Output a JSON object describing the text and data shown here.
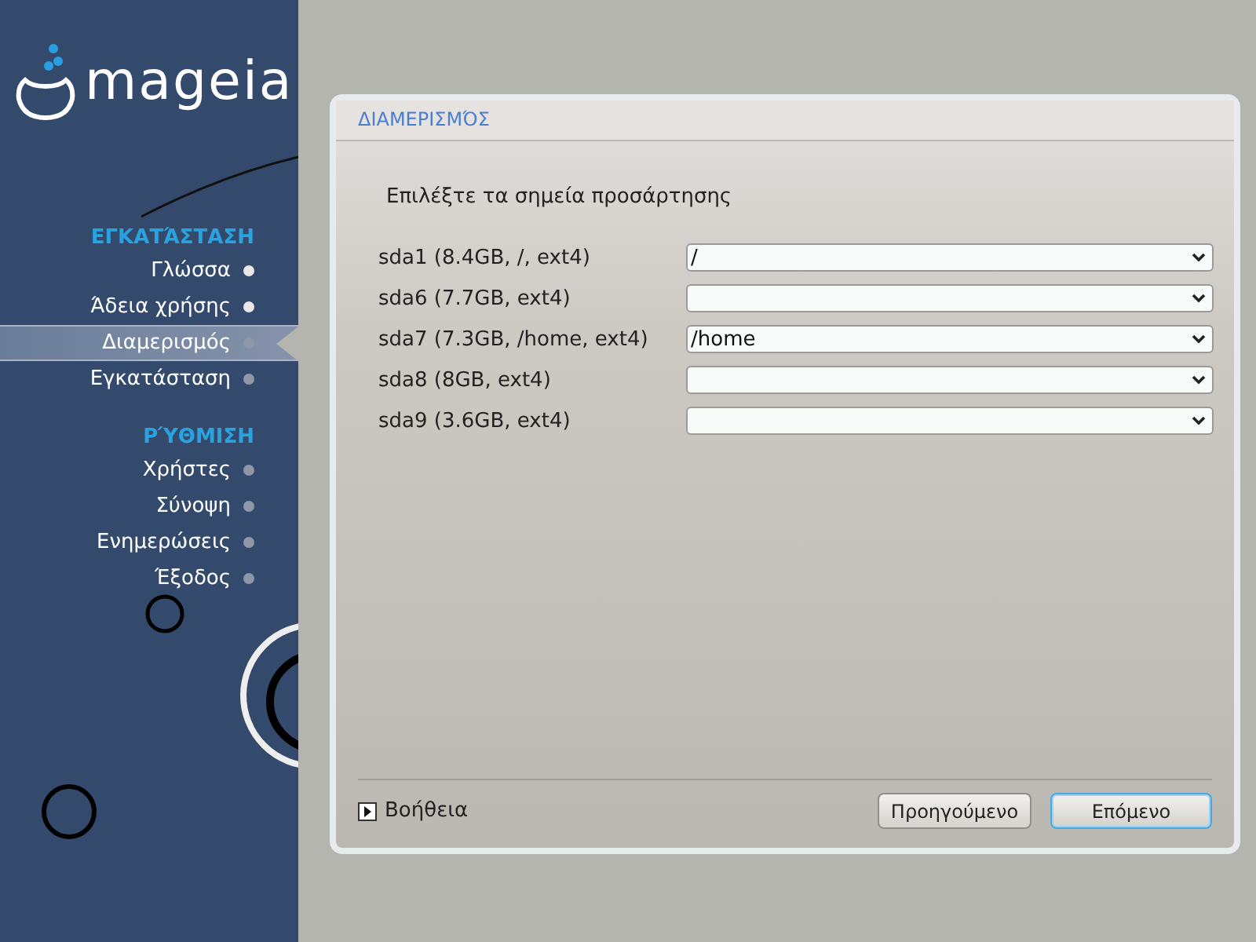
{
  "logo": {
    "text": "mageia"
  },
  "steps": [
    {
      "title": "ΕΓΚΑΤΆΣΤΑΣΗ",
      "items": [
        {
          "label": "Γλώσσα",
          "selected": false,
          "done": true
        },
        {
          "label": "Άδεια χρήσης",
          "selected": false,
          "done": true
        },
        {
          "label": "Διαμερισμός",
          "selected": true,
          "done": false
        },
        {
          "label": "Εγκατάσταση",
          "selected": false,
          "done": false
        }
      ]
    },
    {
      "title": "ΡΎΘΜΙΣΗ",
      "items": [
        {
          "label": "Χρήστες",
          "selected": false,
          "done": false
        },
        {
          "label": "Σύνοψη",
          "selected": false,
          "done": false
        },
        {
          "label": "Ενημερώσεις",
          "selected": false,
          "done": false
        },
        {
          "label": "Έξοδος",
          "selected": false,
          "done": false
        }
      ]
    }
  ],
  "panel": {
    "title": "ΔΙΑΜΕΡΙΣΜΌΣ",
    "instruction": "Επιλέξτε τα σημεία προσάρτησης",
    "partitions": [
      {
        "label": "sda1 (8.4GB, /, ext4)",
        "mount": "/"
      },
      {
        "label": "sda6 (7.7GB, ext4)"
      },
      {
        "label": "sda7 (7.3GB, /home, ext4)",
        "mount": "/home"
      },
      {
        "label": "sda8 (8GB, ext4)"
      },
      {
        "label": "sda9 (3.6GB, ext4)"
      }
    ],
    "help": "Βοήθεια",
    "buttons": [
      {
        "label": "Προηγούμενο",
        "focused": false
      },
      {
        "label": "Επόμενο",
        "focused": true
      }
    ]
  }
}
